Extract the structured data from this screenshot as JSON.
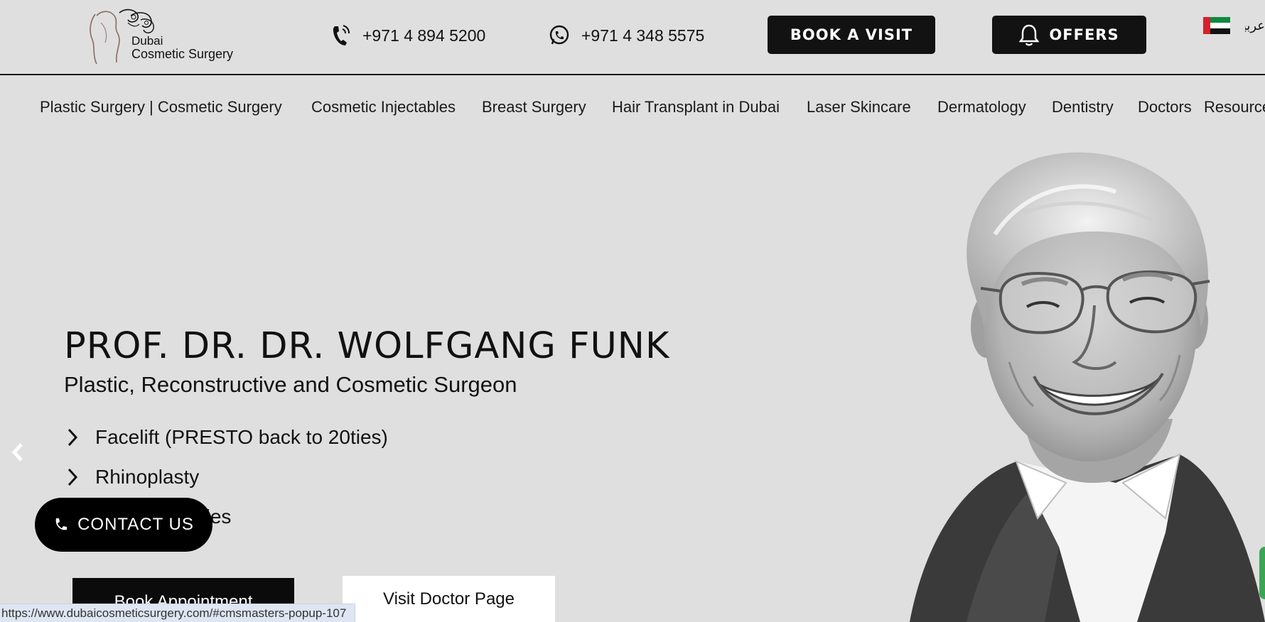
{
  "header": {
    "logo": {
      "line1": "Dubai",
      "line2": "Cosmetic Surgery"
    },
    "phone1": {
      "icon": "phone-icon",
      "number": "+971 4 894 5200"
    },
    "phone2": {
      "icon": "whatsapp-icon",
      "number": "+971 4 348 5575"
    },
    "book_label": "BOOK A VISIT",
    "offers_label": "OFFERS",
    "offers_icon": "bell-icon",
    "flag_icon": "uae-flag-icon",
    "language_label": "عربية"
  },
  "nav": {
    "items": [
      "Plastic Surgery | Cosmetic Surgery",
      "Cosmetic Injectables",
      "Breast Surgery",
      "Hair Transplant in Dubai",
      "Laser Skincare",
      "Dermatology",
      "Dentistry",
      "Doctors",
      "Resources"
    ]
  },
  "hero": {
    "title": "PROF. DR. DR. WOLFGANG FUNK",
    "subtitle": "Plastic, Reconstructive and Cosmetic Surgeon",
    "specialties": [
      "Facelift (PRESTO back to 20ties)",
      "Rhinoplasty",
      "Body Surgeries"
    ],
    "prev_icon": "chevron-left-icon",
    "book_appointment_label": "Book Appointment",
    "visit_doctor_label": "Visit Doctor Page"
  },
  "contact": {
    "label": "CONTACT US",
    "icon": "phone-icon"
  },
  "status_bar": {
    "url": "https://www.dubaicosmeticsurgery.com/#cmsmasters-popup-107"
  },
  "colors": {
    "background": "#dfdfdf",
    "button_dark": "#121212",
    "text": "#111111"
  }
}
